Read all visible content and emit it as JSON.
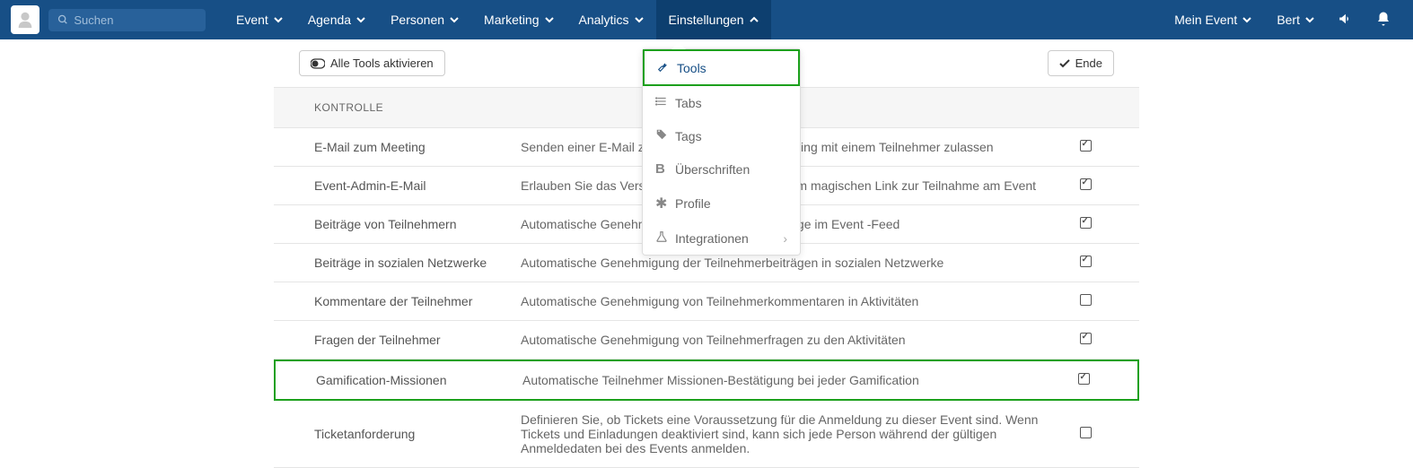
{
  "search": {
    "placeholder": "Suchen"
  },
  "nav": {
    "items": [
      {
        "label": "Event"
      },
      {
        "label": "Agenda"
      },
      {
        "label": "Personen"
      },
      {
        "label": "Marketing"
      },
      {
        "label": "Analytics"
      },
      {
        "label": "Einstellungen"
      }
    ],
    "right": [
      {
        "label": "Mein Event"
      },
      {
        "label": "Bert"
      }
    ]
  },
  "toolbar": {
    "activate_label": "Alle Tools aktivieren",
    "end_label": "Ende"
  },
  "section": {
    "title": "KONTROLLE"
  },
  "dropdown": {
    "items": [
      {
        "label": "Tools"
      },
      {
        "label": "Tabs"
      },
      {
        "label": "Tags"
      },
      {
        "label": "Überschriften"
      },
      {
        "label": "Profile"
      },
      {
        "label": "Integrationen"
      }
    ]
  },
  "rows": [
    {
      "name": "E-Mail zum Meeting",
      "desc": "Senden einer E-Mail zur Einladung zu einem Meeting mit einem Teilnehmer zulassen",
      "checked": true
    },
    {
      "name": "Event-Admin-E-Mail",
      "desc": "Erlauben Sie das Versenden von E-Mails mit einem magischen Link zur Teilnahme am Event",
      "checked": true
    },
    {
      "name": "Beiträge von Teilnehmern",
      "desc": "Automatische Genehmigung der Teilnehmerbeiträge im Event -Feed",
      "checked": true
    },
    {
      "name": "Beiträge in sozialen Netzwerke",
      "desc": "Automatische Genehmigung der Teilnehmerbeiträgen in sozialen Netzwerke",
      "checked": true
    },
    {
      "name": "Kommentare der Teilnehmer",
      "desc": "Automatische Genehmigung von Teilnehmerkommentaren in Aktivitäten",
      "checked": false
    },
    {
      "name": "Fragen der Teilnehmer",
      "desc": "Automatische Genehmigung von Teilnehmerfragen zu den Aktivitäten",
      "checked": true
    },
    {
      "name": "Gamification-Missionen",
      "desc": "Automatische Teilnehmer Missionen-Bestätigung bei jeder Gamification",
      "checked": true,
      "highlighted": true
    },
    {
      "name": "Ticketanforderung",
      "desc": "Definieren Sie, ob Tickets eine Voraussetzung für die Anmeldung zu dieser Event sind. Wenn Tickets und Einladungen deaktiviert sind, kann sich jede Person während der gültigen Anmeldedaten bei des Events anmelden.",
      "checked": false
    }
  ]
}
